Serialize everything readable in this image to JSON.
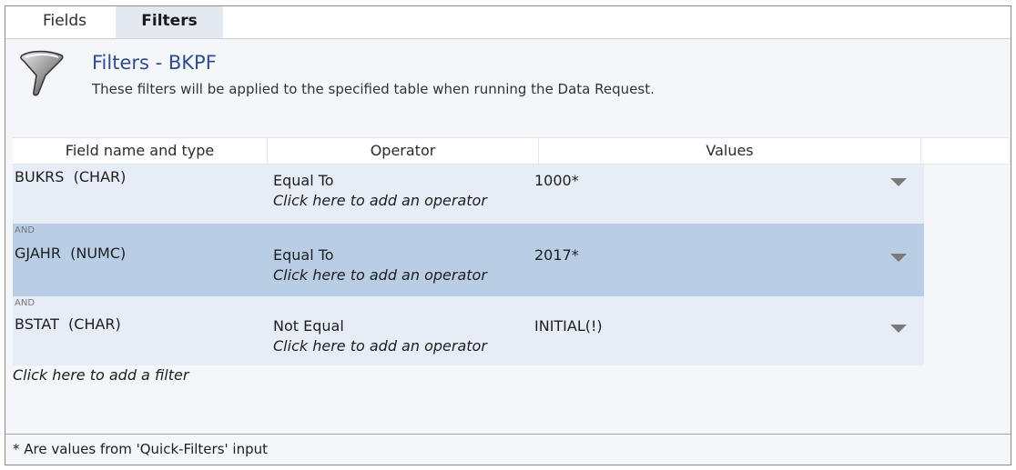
{
  "tabs": [
    {
      "label": "Fields",
      "active": false
    },
    {
      "label": "Filters",
      "active": true
    }
  ],
  "header": {
    "icon": "funnel-icon",
    "title": "Filters - BKPF",
    "subtitle": "These filters will be applied to the specified table when running the Data Request."
  },
  "grid": {
    "columns": [
      "Field name and type",
      "Operator",
      "Values"
    ],
    "rows": [
      {
        "conjunction": "",
        "field": "BUKRS  (CHAR)",
        "operator": "Equal To",
        "add_operator": "Click here to add an operator",
        "value": "1000*",
        "selected": false
      },
      {
        "conjunction": "AND",
        "field": "GJAHR  (NUMC)",
        "operator": "Equal To",
        "add_operator": "Click here to add an operator",
        "value": "2017*",
        "selected": true
      },
      {
        "conjunction": "AND",
        "field": "BSTAT  (CHAR)",
        "operator": "Not Equal",
        "add_operator": "Click here to add an operator",
        "value": "INITIAL(!)",
        "selected": false
      }
    ],
    "add_filter": "Click here to add a filter"
  },
  "footer": {
    "note": "* Are values from 'Quick-Filters' input"
  },
  "colors": {
    "title": "#2c4d8f",
    "active_tab_bg": "#e4e9f1",
    "row_bg": "#e7edf6",
    "selected_row_bg": "#b9cde5"
  }
}
